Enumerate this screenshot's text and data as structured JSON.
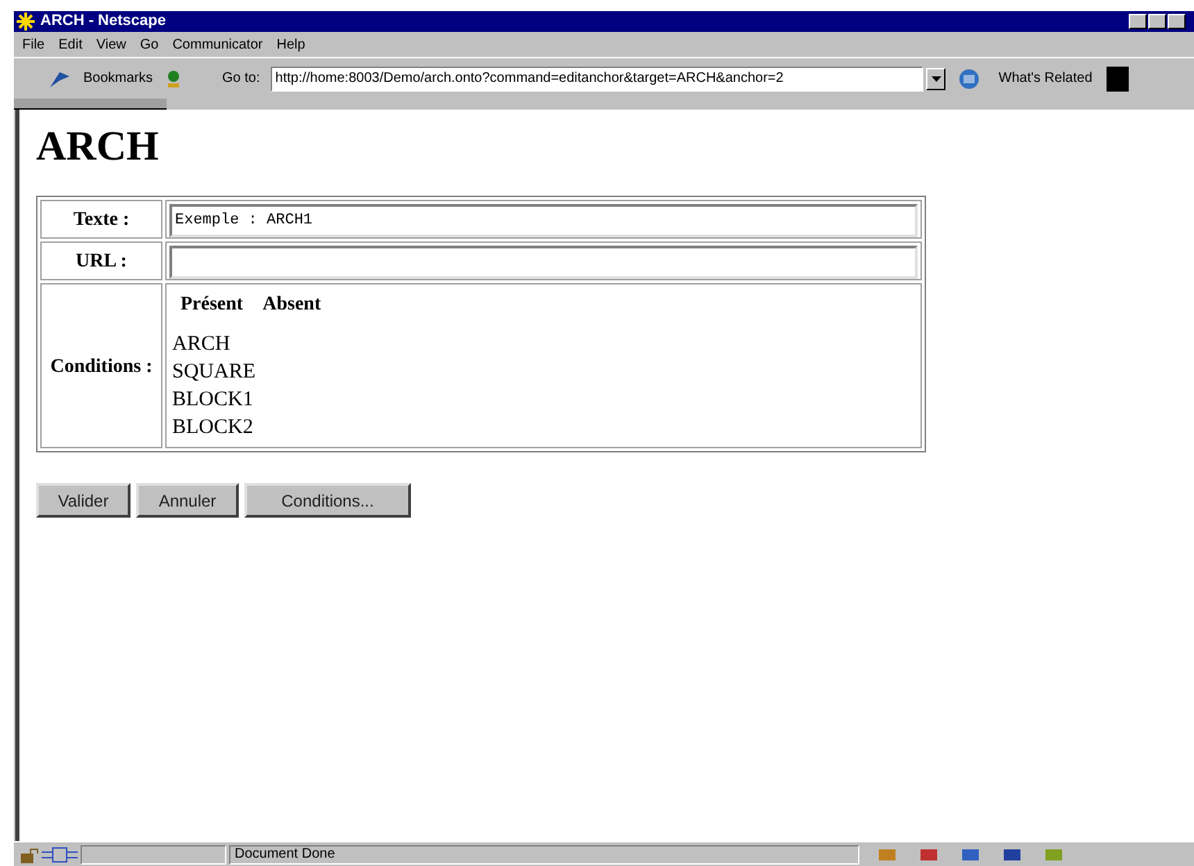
{
  "window": {
    "title": "ARCH - Netscape"
  },
  "menu": [
    "File",
    "Edit",
    "View",
    "Go",
    "Communicator",
    "Help"
  ],
  "toolbar": {
    "bookmarks": "Bookmarks",
    "goto_label": "Go to:",
    "url": "http://home:8003/Demo/arch.onto?command=editanchor&target=ARCH&anchor=2",
    "related": "What's Related"
  },
  "page": {
    "heading": "ARCH",
    "form": {
      "texte_label": "Texte :",
      "texte_value": "Exemple : ARCH1",
      "url_label": "URL :",
      "conditions_label": "Conditions :",
      "condition_columns": [
        "Présent",
        "Absent"
      ],
      "conditions": [
        "ARCH",
        "SQUARE",
        "BLOCK1",
        "BLOCK2"
      ]
    },
    "buttons": [
      "Valider",
      "Annuler",
      "Conditions..."
    ]
  },
  "status_bar": {
    "text": "Document Done"
  }
}
